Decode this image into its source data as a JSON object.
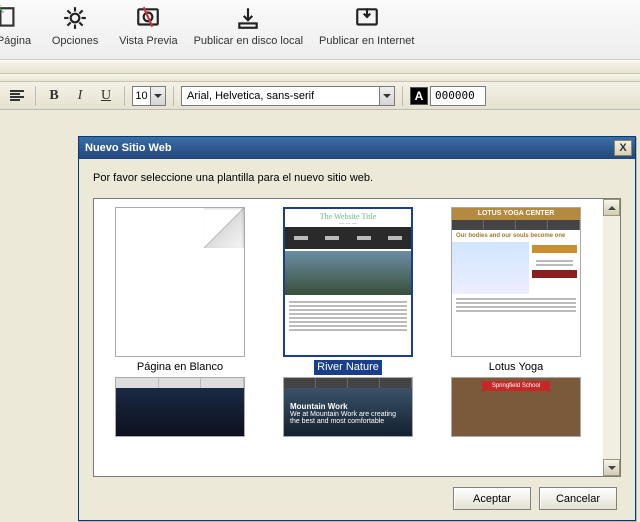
{
  "toolbar": {
    "items": [
      {
        "label": "ar Página",
        "iconName": "page-icon"
      },
      {
        "label": "Opciones",
        "iconName": "gear-icon"
      },
      {
        "label": "Vista Previa",
        "iconName": "preview-icon"
      },
      {
        "label": "Publicar en disco local",
        "iconName": "publish-local-icon"
      },
      {
        "label": "Publicar en Internet",
        "iconName": "publish-internet-icon"
      }
    ]
  },
  "format": {
    "font_size": "10",
    "font_family": "Arial, Helvetica, sans-serif",
    "text_color_hex": "000000",
    "text_color_glyph": "A"
  },
  "dialog": {
    "title": "Nuevo Sitio Web",
    "close_glyph": "X",
    "prompt": "Por favor seleccione una plantilla para el nuevo sitio web.",
    "ok_label": "Aceptar",
    "cancel_label": "Cancelar",
    "templates": [
      {
        "label": "Página en Blanco"
      },
      {
        "label": "River Nature"
      },
      {
        "label": "Lotus Yoga"
      },
      {
        "label": ""
      },
      {
        "label": ""
      },
      {
        "label": ""
      }
    ],
    "thumb_strings": {
      "river_title": "The Website Title",
      "yoga_title": "LOTUS YOGA CENTER",
      "mountain_title": "Mountain Work",
      "mountain_sub": "We at Mountain Work are creating the best and most comfortable",
      "school_badge": "Springfield School"
    }
  }
}
